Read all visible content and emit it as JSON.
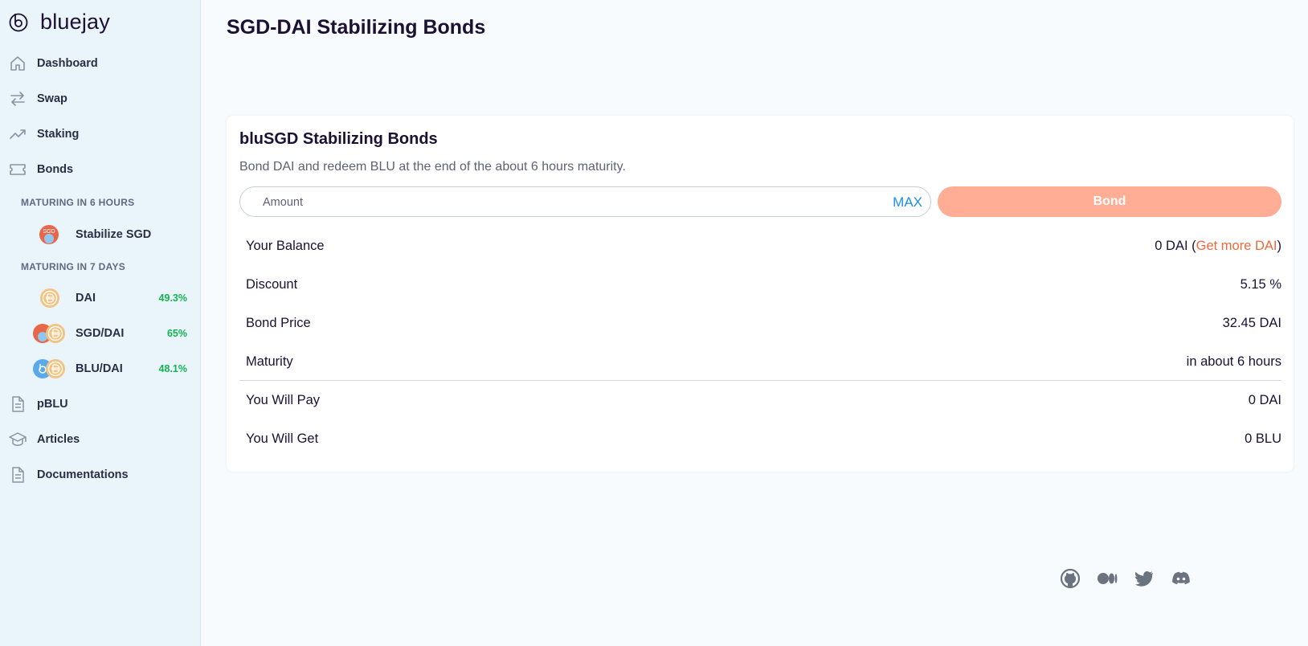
{
  "brand": {
    "name": "bluejay"
  },
  "sidebar": {
    "nav": [
      {
        "label": "Dashboard",
        "icon": "home-icon"
      },
      {
        "label": "Swap",
        "icon": "swap-arrows-icon"
      },
      {
        "label": "Staking",
        "icon": "trending-up-icon"
      },
      {
        "label": "Bonds",
        "icon": "ticket-icon"
      }
    ],
    "groups": [
      {
        "heading": "MATURING IN 6 HOURS",
        "items": [
          {
            "label": "Stabilize SGD",
            "apy": "",
            "icon": "sgd-token-icon"
          }
        ]
      },
      {
        "heading": "MATURING IN 7 DAYS",
        "items": [
          {
            "label": "DAI",
            "apy": "49.3%",
            "icon": "dai-token-icon"
          },
          {
            "label": "SGD/DAI",
            "apy": "65%",
            "icon": "sgd-dai-lp-icon"
          },
          {
            "label": "BLU/DAI",
            "apy": "48.1%",
            "icon": "blu-dai-lp-icon"
          }
        ]
      }
    ],
    "nav_bottom": [
      {
        "label": "pBLU",
        "icon": "document-icon"
      },
      {
        "label": "Articles",
        "icon": "graduation-cap-icon"
      },
      {
        "label": "Documentations",
        "icon": "document-icon"
      }
    ]
  },
  "page": {
    "title": "SGD-DAI Stabilizing Bonds"
  },
  "card": {
    "title": "bluSGD Stabilizing Bonds",
    "subtitle": "Bond DAI and redeem BLU at the end of the about 6 hours maturity.",
    "amount_placeholder": "Amount",
    "max_label": "MAX",
    "bond_label": "Bond",
    "rows": {
      "balance": {
        "label": "Your Balance",
        "value_prefix": "0 DAI (",
        "link": "Get more DAI",
        "value_suffix": ")"
      },
      "discount": {
        "label": "Discount",
        "value": "5.15 %"
      },
      "price": {
        "label": "Bond Price",
        "value": "32.45 DAI"
      },
      "maturity": {
        "label": "Maturity",
        "value": "in about 6 hours"
      },
      "pay": {
        "label": "You Will Pay",
        "value": "0 DAI"
      },
      "get": {
        "label": "You Will Get",
        "value": "0 BLU"
      }
    }
  },
  "socials": [
    "github-icon",
    "medium-icon",
    "twitter-icon",
    "discord-icon"
  ],
  "colors": {
    "accent": "#ee6a3a",
    "bond_button": "#ffae95",
    "apy_green": "#12b351",
    "max_blue": "#1d8fe0",
    "sidebar_bg": "#eaf4fb"
  }
}
